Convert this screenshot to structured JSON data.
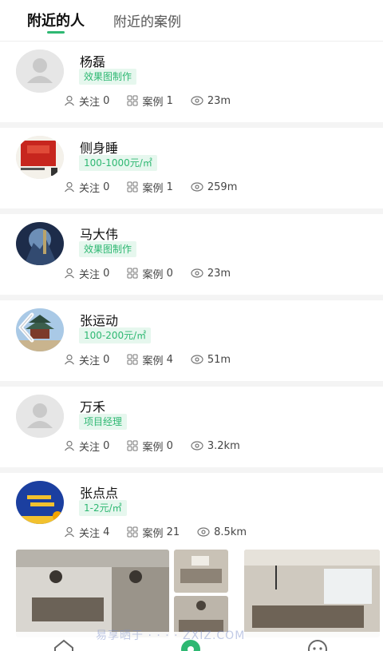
{
  "tabs": [
    {
      "label": "附近的人",
      "active": true
    },
    {
      "label": "附近的案例",
      "active": false
    }
  ],
  "users": [
    {
      "name": "杨磊",
      "tag": "效果图制作",
      "follow_label": "关注",
      "follow": "0",
      "case_label": "案例",
      "cases": "1",
      "distance": "23m",
      "avatar": "default-avatar"
    },
    {
      "name": "侧身睡",
      "tag": "100-1000元/㎡",
      "follow_label": "关注",
      "follow": "0",
      "case_label": "案例",
      "cases": "1",
      "distance": "259m",
      "avatar": "red-book-avatar"
    },
    {
      "name": "马大伟",
      "tag": "效果图制作",
      "follow_label": "关注",
      "follow": "0",
      "case_label": "案例",
      "cases": "0",
      "distance": "23m",
      "avatar": "night-scene-avatar"
    },
    {
      "name": "张运动",
      "tag": "100-200元/㎡",
      "follow_label": "关注",
      "follow": "0",
      "case_label": "案例",
      "cases": "4",
      "distance": "51m",
      "avatar": "temple-avatar"
    },
    {
      "name": "万禾",
      "tag": "项目经理",
      "follow_label": "关注",
      "follow": "0",
      "case_label": "案例",
      "cases": "0",
      "distance": "3.2km",
      "avatar": "default-avatar"
    },
    {
      "name": "张点点",
      "tag": "1-2元/㎡",
      "follow_label": "关注",
      "follow": "4",
      "case_label": "案例",
      "cases": "21",
      "distance": "8.5km",
      "avatar": "blue-logo-avatar"
    }
  ],
  "watermark": "易享晒于 · · · · ZXIZ.COM",
  "colors": {
    "accent": "#2eb872",
    "tag_bg": "#e6f7ee"
  }
}
